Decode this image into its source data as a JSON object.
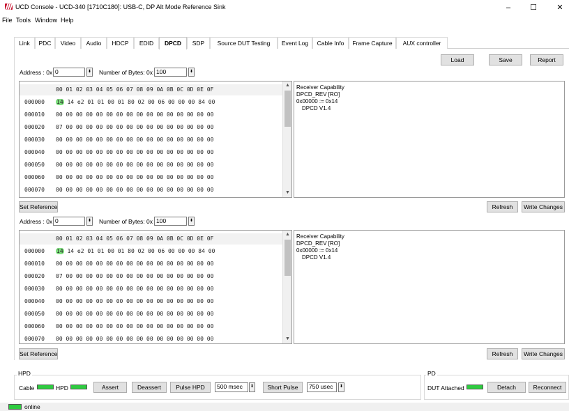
{
  "window": {
    "title": "UCD Console - UCD-340 [1710C180]: USB-C, DP Alt Mode Reference Sink",
    "minimize": "–",
    "maximize": "☐",
    "close": "✕"
  },
  "menu": [
    "File",
    "Tools",
    "Window",
    "Help"
  ],
  "tabs": [
    "Link",
    "PDC",
    "Video",
    "Audio",
    "HDCP",
    "EDID",
    "DPCD",
    "SDP",
    "Source DUT Testing",
    "Event Log",
    "Cable Info",
    "Frame Capture",
    "AUX controller"
  ],
  "active_tab": "DPCD",
  "toolbar": {
    "load": "Load",
    "save": "Save",
    "report": "Report"
  },
  "panels": [
    {
      "address_label": "Address : 0x",
      "address_value": "0",
      "bytes_label": "Number of Bytes: 0x",
      "bytes_value": "100",
      "header": "00 01 02 03 04 05 06 07 08 09 0A 0B 0C 0D 0E 0F",
      "rows": [
        {
          "addr": "000000",
          "first": "14",
          "rest": " 14 e2 01 01 00 01 80 02 00 06 00 00 00 84 00"
        },
        {
          "addr": "000010",
          "first": "00",
          "rest": " 00 00 00 00 00 00 00 00 00 00 00 00 00 00 00"
        },
        {
          "addr": "000020",
          "first": "07",
          "rest": " 00 00 00 00 00 00 00 00 00 00 00 00 00 00 00"
        },
        {
          "addr": "000030",
          "first": "00",
          "rest": " 00 00 00 00 00 00 00 00 00 00 00 00 00 00 00"
        },
        {
          "addr": "000040",
          "first": "00",
          "rest": " 00 00 00 00 00 00 00 00 00 00 00 00 00 00 00"
        },
        {
          "addr": "000050",
          "first": "00",
          "rest": " 00 00 00 00 00 00 00 00 00 00 00 00 00 00 00"
        },
        {
          "addr": "000060",
          "first": "00",
          "rest": " 00 00 00 00 00 00 00 00 00 00 00 00 00 00 00"
        },
        {
          "addr": "000070",
          "first": "00",
          "rest": " 00 00 00 00 00 00 00 00 00 00 00 00 00 00 00"
        }
      ],
      "info": [
        "Receiver Capability",
        "DPCD_REV [RO]",
        "0x00000 := 0x14",
        "DPCD V1.4"
      ],
      "set_reference": "Set Reference",
      "refresh": "Refresh",
      "write_changes": "Write Changes"
    },
    {
      "address_label": "Address : 0x",
      "address_value": "0",
      "bytes_label": "Number of Bytes: 0x",
      "bytes_value": "100",
      "header": "00 01 02 03 04 05 06 07 08 09 0A 0B 0C 0D 0E 0F",
      "rows": [
        {
          "addr": "000000",
          "first": "14",
          "rest": " 14 e2 01 01 00 01 80 02 00 06 00 00 00 84 00"
        },
        {
          "addr": "000010",
          "first": "00",
          "rest": " 00 00 00 00 00 00 00 00 00 00 00 00 00 00 00"
        },
        {
          "addr": "000020",
          "first": "07",
          "rest": " 00 00 00 00 00 00 00 00 00 00 00 00 00 00 00"
        },
        {
          "addr": "000030",
          "first": "00",
          "rest": " 00 00 00 00 00 00 00 00 00 00 00 00 00 00 00"
        },
        {
          "addr": "000040",
          "first": "00",
          "rest": " 00 00 00 00 00 00 00 00 00 00 00 00 00 00 00"
        },
        {
          "addr": "000050",
          "first": "00",
          "rest": " 00 00 00 00 00 00 00 00 00 00 00 00 00 00 00"
        },
        {
          "addr": "000060",
          "first": "00",
          "rest": " 00 00 00 00 00 00 00 00 00 00 00 00 00 00 00"
        },
        {
          "addr": "000070",
          "first": "00",
          "rest": " 00 00 00 00 00 00 00 00 00 00 00 00 00 00 00"
        }
      ],
      "info": [
        "Receiver Capability",
        "DPCD_REV [RO]",
        "0x00000 := 0x14",
        "DPCD V1.4"
      ],
      "set_reference": "Set Reference",
      "refresh": "Refresh",
      "write_changes": "Write Changes"
    }
  ],
  "hpd": {
    "title": "HPD",
    "cable_label": "Cable",
    "hpd_label": "HPD",
    "assert": "Assert",
    "deassert": "Deassert",
    "pulse_hpd": "Pulse HPD",
    "pulse_duration": "500 msec",
    "short_pulse": "Short Pulse",
    "short_duration": "750 usec"
  },
  "pd": {
    "title": "PD",
    "dut_attached_label": "DUT Attached",
    "detach": "Detach",
    "reconnect": "Reconnect"
  },
  "status": {
    "text": "online"
  },
  "colors": {
    "indicator_green": "#2ecc40",
    "highlight_green": "#7fe07f",
    "logo_red": "#c8102e"
  }
}
